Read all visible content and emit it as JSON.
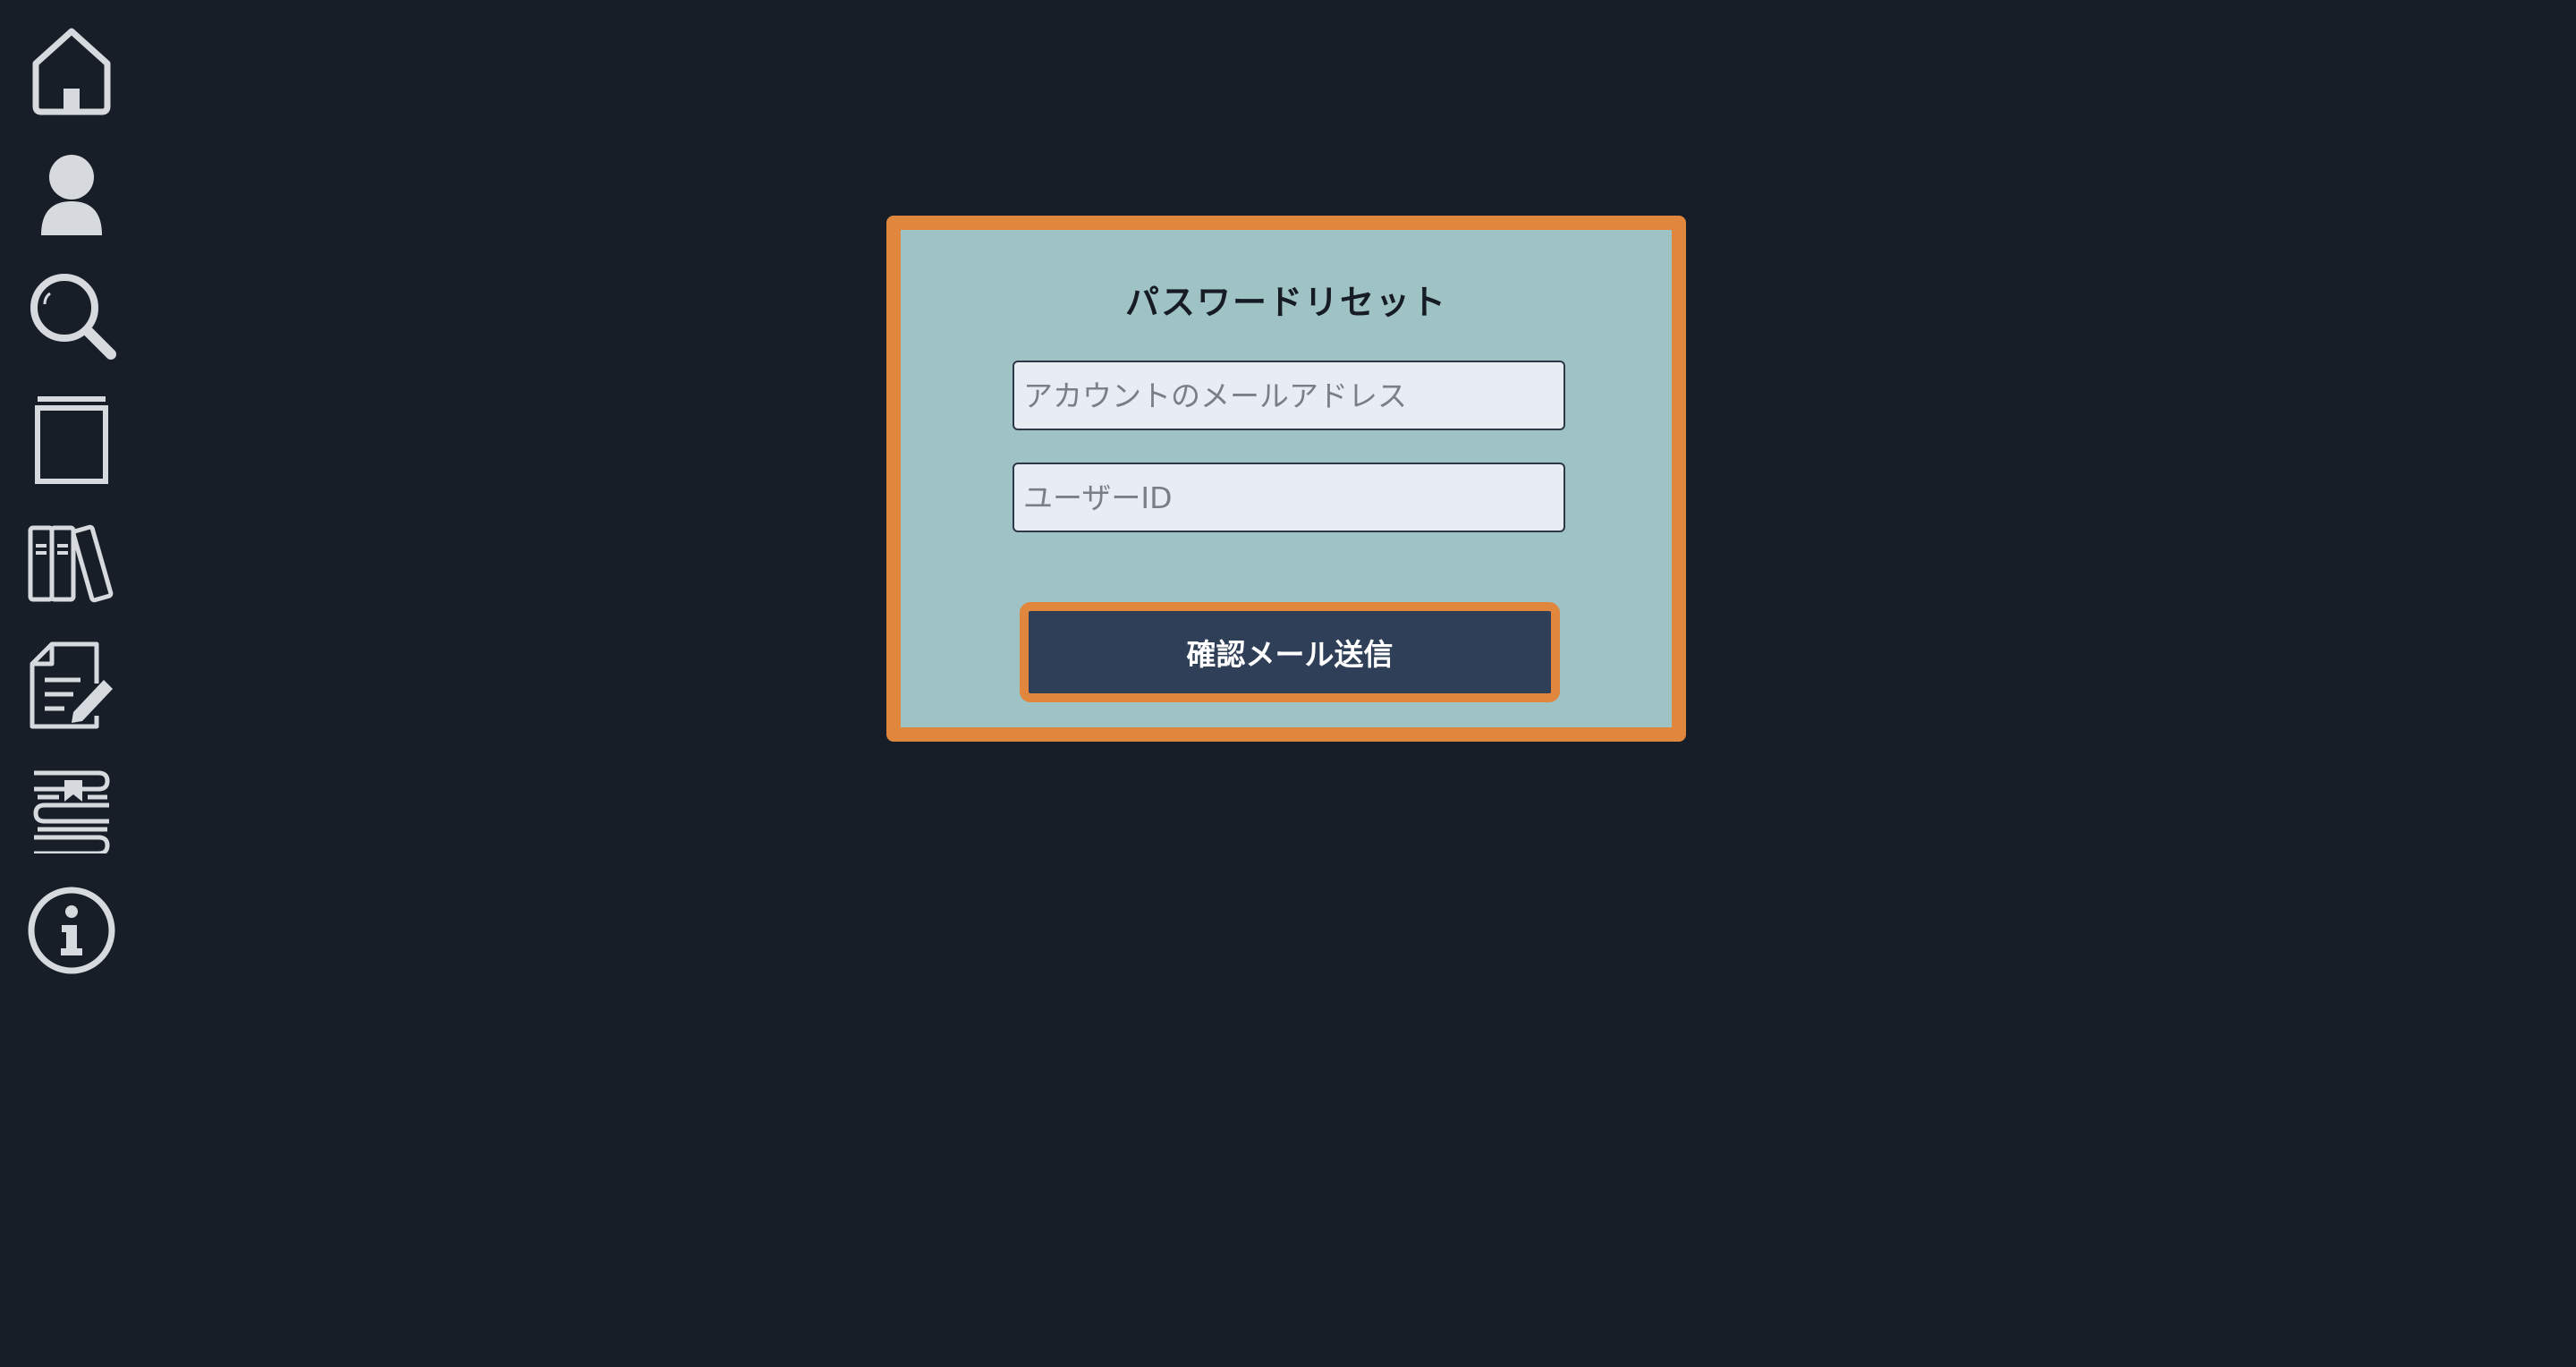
{
  "sidebar": {
    "items": [
      {
        "icon": "home-icon"
      },
      {
        "icon": "user-icon"
      },
      {
        "icon": "search-icon"
      },
      {
        "icon": "book-icon"
      },
      {
        "icon": "library-icon"
      },
      {
        "icon": "edit-document-icon"
      },
      {
        "icon": "bookmarked-books-icon"
      },
      {
        "icon": "info-icon"
      }
    ]
  },
  "form": {
    "title": "パスワードリセット",
    "email_placeholder": "アカウントのメールアドレス",
    "email_value": "",
    "userid_placeholder": "ユーザーID",
    "userid_value": "",
    "submit_label": "確認メール送信"
  },
  "colors": {
    "background": "#181e28",
    "panel": "#9fc3c4",
    "accent": "#e0873d",
    "button": "#2f3f57",
    "icon": "#d6d9de"
  }
}
